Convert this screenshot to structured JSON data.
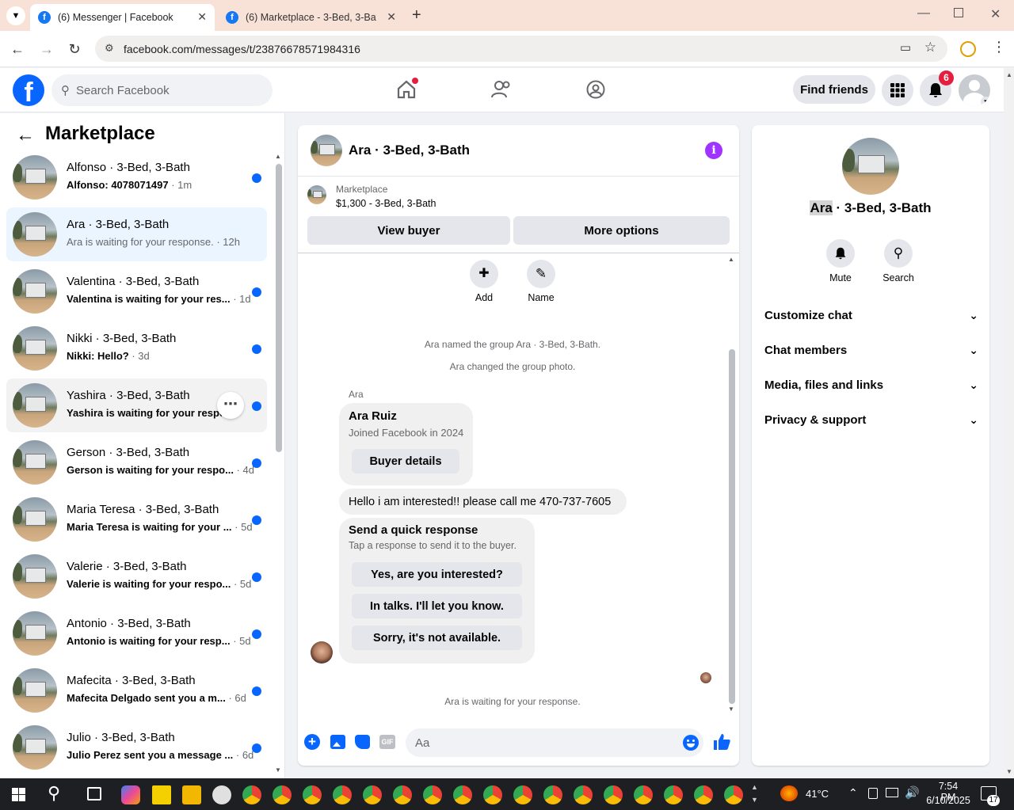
{
  "browser": {
    "tabs": [
      {
        "label": "(6) Messenger | Facebook",
        "active": true
      },
      {
        "label": "(6) Marketplace - 3-Bed, 3-Bath",
        "active": false
      }
    ],
    "url": "facebook.com/messages/t/23876678571984316"
  },
  "header": {
    "search_placeholder": "Search Facebook",
    "find_friends": "Find friends",
    "notif_count": "6",
    "logo_letter": "f"
  },
  "left": {
    "title": "Marketplace",
    "conversations": [
      {
        "name": "Alfonso · 3-Bed, 3-Bath",
        "preview": "Alfonso: 4078071497",
        "time": " · 1m"
      },
      {
        "name": "Ara · 3-Bed, 3-Bath",
        "preview": "Ara is waiting for your response.",
        "time": " · 12h"
      },
      {
        "name": "Valentina · 3-Bed, 3-Bath",
        "preview": "Valentina is waiting for your res...",
        "time": " · 1d"
      },
      {
        "name": "Nikki · 3-Bed, 3-Bath",
        "preview": "Nikki: Hello?",
        "time": " · 3d"
      },
      {
        "name": "Yashira · 3-Bed, 3-Bath",
        "preview": "Yashira is waiting for your respo...",
        "time": ""
      },
      {
        "name": "Gerson · 3-Bed, 3-Bath",
        "preview": "Gerson is waiting for your respo...",
        "time": " · 4d"
      },
      {
        "name": "Maria Teresa · 3-Bed, 3-Bath",
        "preview": "Maria Teresa is waiting for your ...",
        "time": " · 5d"
      },
      {
        "name": "Valerie · 3-Bed, 3-Bath",
        "preview": "Valerie is waiting for your respo...",
        "time": " · 5d"
      },
      {
        "name": "Antonio · 3-Bed, 3-Bath",
        "preview": "Antonio is waiting for your resp...",
        "time": " · 5d"
      },
      {
        "name": "Mafecita · 3-Bed, 3-Bath",
        "preview": "Mafecita Delgado sent you a m...",
        "time": " · 6d"
      },
      {
        "name": "Julio · 3-Bed, 3-Bath",
        "preview": "Julio Perez sent you a message ...",
        "time": " · 6d"
      }
    ]
  },
  "chat": {
    "title": "Ara · 3-Bed, 3-Bath",
    "listing_source": "Marketplace",
    "listing": "$1,300 - 3-Bed, 3-Bath",
    "view_buyer": "View buyer",
    "more_options": "More options",
    "add_label": "Add",
    "name_label": "Name",
    "sys1": "Ara named the group Ara · 3-Bed, 3-Bath.",
    "sys2": "Ara changed the group photo.",
    "sender": "Ara",
    "profile_name": "Ara Ruiz",
    "profile_joined": "Joined Facebook in 2024",
    "buyer_details": "Buyer details",
    "message": "Hello i am interested!! please call me 470-737-7605",
    "quick_title": "Send a quick response",
    "quick_sub": "Tap a response to send it to the buyer.",
    "quick_options": [
      "Yes, are you interested?",
      "In talks. I'll let you know.",
      "Sorry, it's not available."
    ],
    "waiting": "Ara is waiting for your response.",
    "composer_placeholder": "Aa"
  },
  "info": {
    "name_highlight": "Ara",
    "name_rest": " · 3-Bed, 3-Bath",
    "mute": "Mute",
    "search": "Search",
    "sections": [
      "Customize chat",
      "Chat members",
      "Media, files and links",
      "Privacy & support"
    ]
  },
  "taskbar": {
    "temp": "41°C",
    "time": "7:54 PM",
    "date": "6/10/2025",
    "notif": "17"
  }
}
